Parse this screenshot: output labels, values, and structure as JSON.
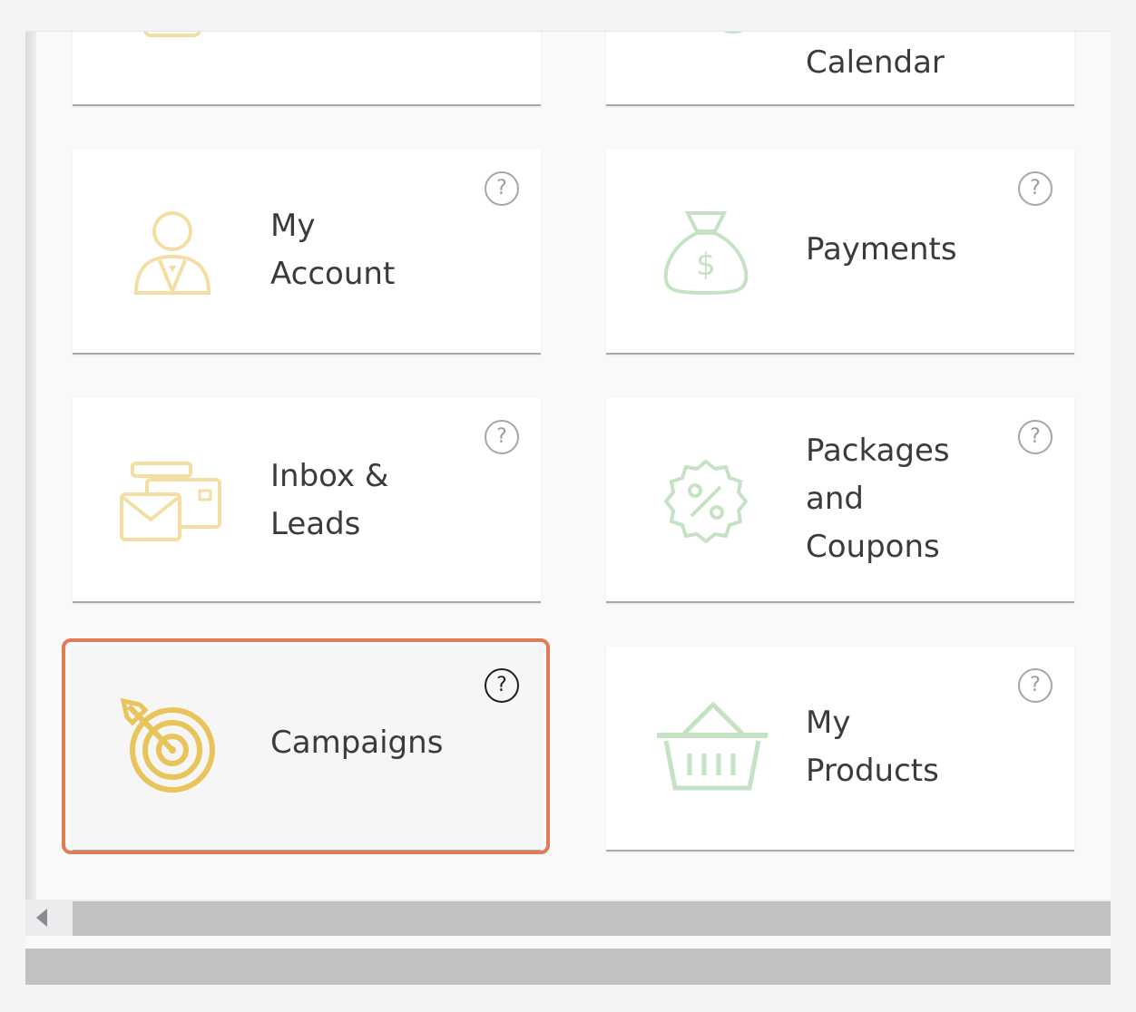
{
  "cards": {
    "top_left": {
      "label": ""
    },
    "calendar": {
      "label": "Calendar"
    },
    "my_account": {
      "label": "My\nAccount",
      "help": "?"
    },
    "payments": {
      "label": "Payments",
      "help": "?"
    },
    "inbox_leads": {
      "label": "Inbox &\nLeads",
      "help": "?"
    },
    "packages": {
      "label": "Packages\nand\nCoupons",
      "help": "?"
    },
    "campaigns": {
      "label": "Campaigns",
      "help": "?",
      "selected": true
    },
    "my_products": {
      "label": "My\nProducts",
      "help": "?"
    }
  },
  "icons": {
    "my_account": "user-icon",
    "payments": "money-bag-icon",
    "inbox_leads": "mail-card-icon",
    "packages": "discount-badge-icon",
    "campaigns": "target-icon",
    "my_products": "basket-icon"
  },
  "colors": {
    "yellow": "#f3dea3",
    "yellow_active": "#e9c45a",
    "green": "#c6e2c4",
    "highlight": "#e07b55",
    "label": "#3b3b3f"
  }
}
